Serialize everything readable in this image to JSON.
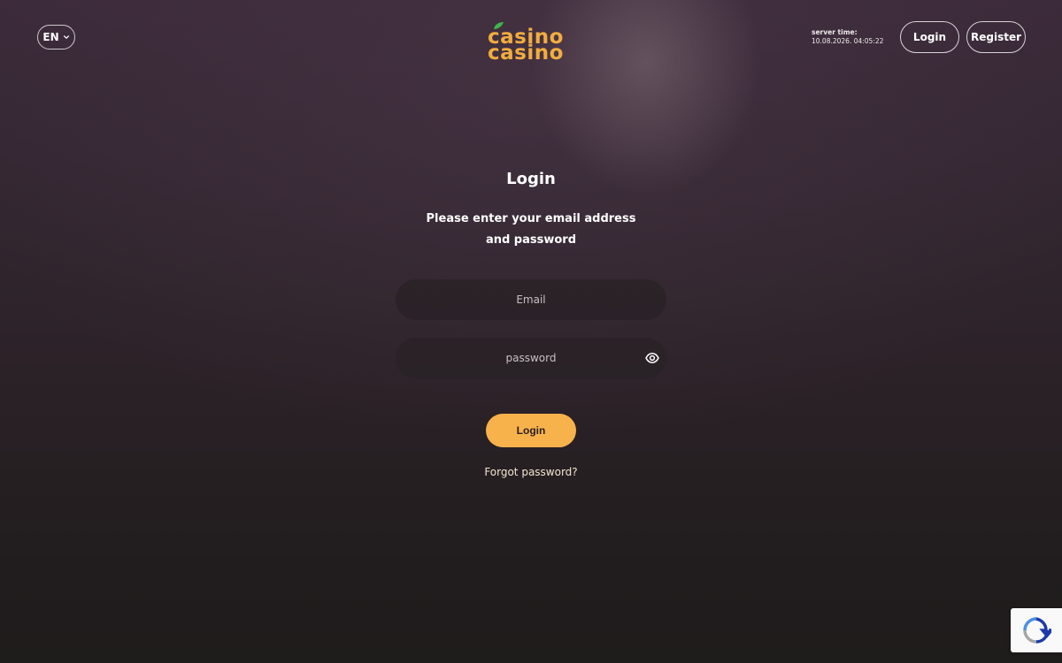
{
  "header": {
    "language": "EN",
    "logo": {
      "line1": "casino",
      "line2": "casino"
    },
    "server_time_label": "server time:",
    "server_time_value": "10.08.2026. 04:05:22",
    "login_label": "Login",
    "register_label": "Register"
  },
  "form": {
    "title": "Login",
    "subtitle": "Please enter your email address and password",
    "email_placeholder": "Email",
    "password_placeholder": "password",
    "submit_label": "Login",
    "forgot_label": "Forgot password?"
  },
  "icons": {
    "language_chevron": "chevron-down-icon",
    "password_toggle": "eye-icon",
    "captcha": "recaptcha-icon"
  },
  "colors": {
    "accent": "#f8b24b",
    "logo": "#f2ad3f"
  }
}
